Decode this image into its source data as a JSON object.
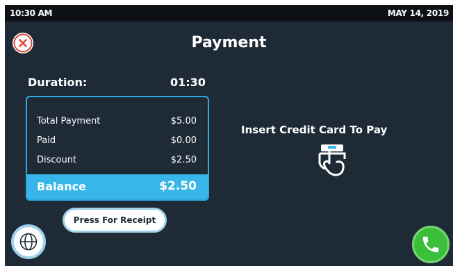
{
  "status": {
    "time": "10:30 AM",
    "date": "MAY 14, 2019"
  },
  "header": {
    "title": "Payment",
    "close_icon": "close-icon"
  },
  "duration": {
    "label": "Duration:",
    "value": "01:30"
  },
  "summary": {
    "rows": [
      {
        "label": "Total Payment",
        "value": "$5.00"
      },
      {
        "label": "Paid",
        "value": "$0.00"
      },
      {
        "label": "Discount",
        "value": "$2.50"
      }
    ],
    "balance": {
      "label": "Balance",
      "value": "$2.50"
    }
  },
  "receipt_button": {
    "label": "Press For Receipt"
  },
  "payment_prompt": {
    "text": "Insert Credit Card To Pay",
    "icon": "insert-card-icon"
  },
  "footer": {
    "language_icon": "globe-icon",
    "call_icon": "phone-icon"
  },
  "colors": {
    "background": "#1e2b36",
    "accent": "#38b6ea",
    "call": "#3bbf3b",
    "close": "#e0403a"
  }
}
